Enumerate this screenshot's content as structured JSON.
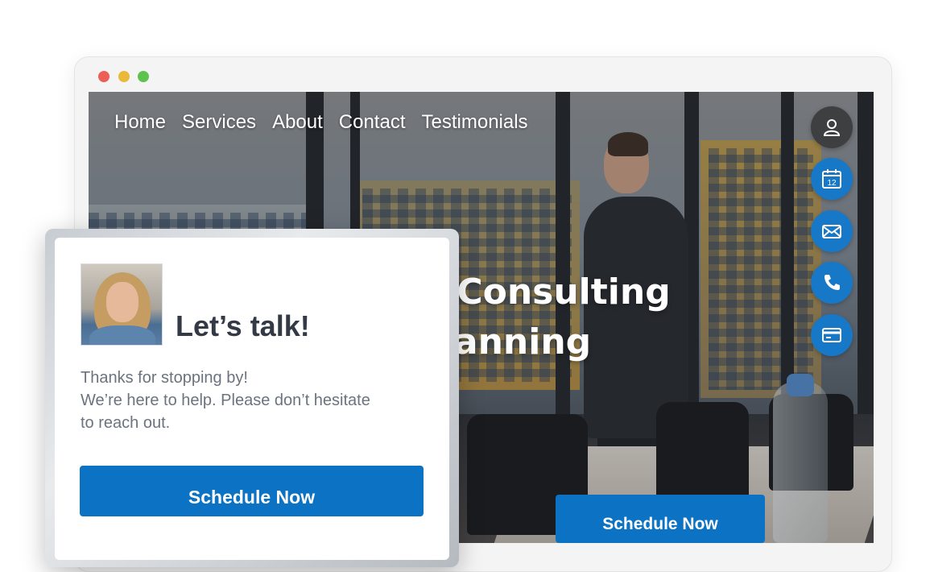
{
  "browser": {
    "window_controls": [
      "close",
      "minimize",
      "maximize"
    ]
  },
  "nav": {
    "items": [
      {
        "label": "Home"
      },
      {
        "label": "Services"
      },
      {
        "label": "About"
      },
      {
        "label": "Contact"
      },
      {
        "label": "Testimonials"
      }
    ]
  },
  "hero": {
    "title_line1": "Consulting",
    "title_line2": "lanning",
    "cta_label": "Schedule Now"
  },
  "side_actions": {
    "items": [
      {
        "icon": "user-icon"
      },
      {
        "icon": "calendar-icon",
        "text": "12"
      },
      {
        "icon": "mail-icon"
      },
      {
        "icon": "phone-icon"
      },
      {
        "icon": "credit-card-icon"
      }
    ]
  },
  "popup": {
    "title": "Let’s talk!",
    "message_line1": "Thanks for stopping by!",
    "message_line2": "We’re here to help. Please don’t hesitate",
    "message_line3": "to reach out.",
    "cta_label": "Schedule Now"
  },
  "colors": {
    "accent": "#0b72c4",
    "dark_fab": "#3d3f41",
    "text_dark": "#343a45",
    "text_muted": "#6c737e"
  }
}
